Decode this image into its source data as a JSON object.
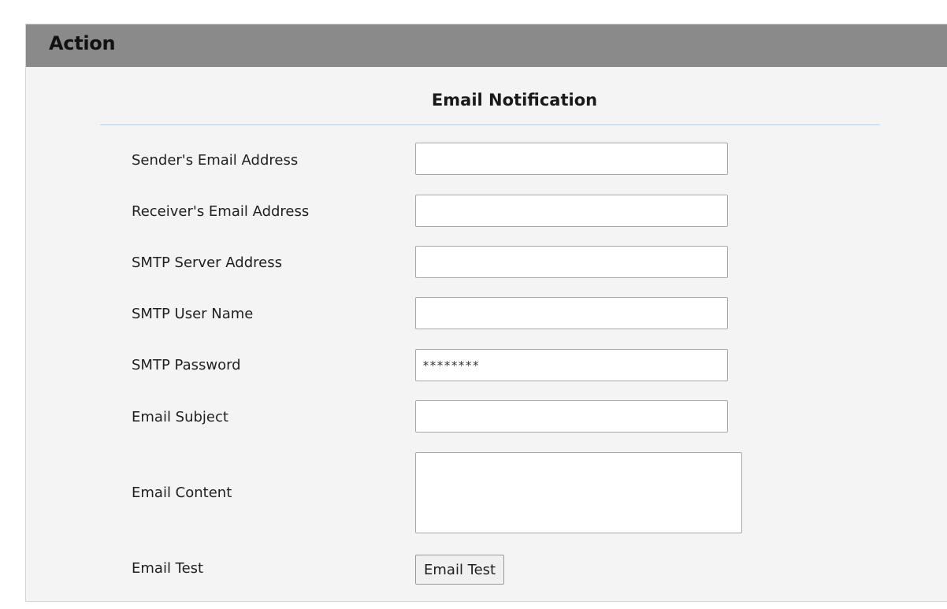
{
  "header": {
    "title": "Action"
  },
  "section": {
    "title": "Email Notification"
  },
  "fields": {
    "sender_email": {
      "label": "Sender's Email Address",
      "value": ""
    },
    "receiver_email": {
      "label": "Receiver's Email Address",
      "value": ""
    },
    "smtp_server": {
      "label": "SMTP Server Address",
      "value": ""
    },
    "smtp_user": {
      "label": "SMTP User Name",
      "value": ""
    },
    "smtp_password": {
      "label": "SMTP Password",
      "value": "********"
    },
    "email_subject": {
      "label": "Email Subject",
      "value": ""
    },
    "email_content": {
      "label": "Email Content",
      "value": ""
    },
    "email_test": {
      "label": "Email Test",
      "button_label": "Email Test"
    }
  },
  "colors": {
    "header_bg": "#8a8a8a",
    "panel_bg": "#f4f4f4",
    "divider": "#b9cde8"
  }
}
